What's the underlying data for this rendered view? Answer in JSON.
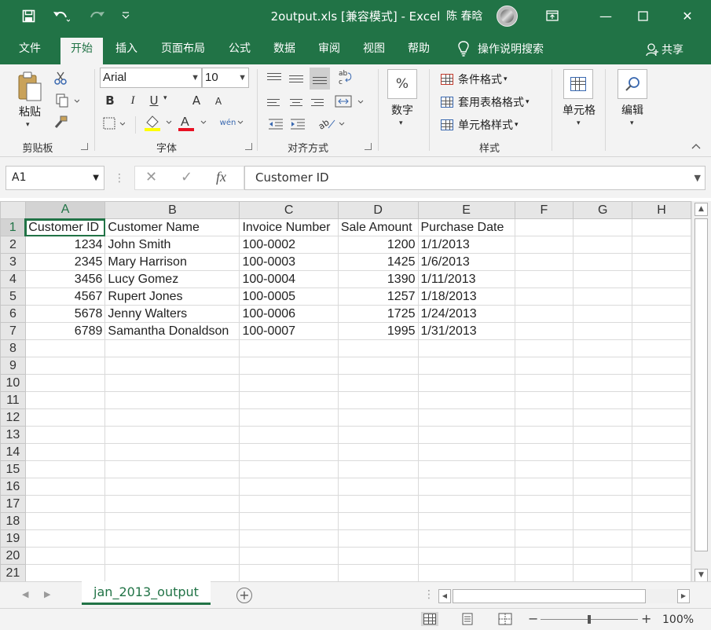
{
  "window": {
    "title": "2output.xls  [兼容模式]  -  Excel",
    "user": "陈 春晗",
    "minimize_glyph": "—",
    "restore_glyph": "❐",
    "close_glyph": "✕"
  },
  "quick_access": {
    "save_icon": "save-icon",
    "undo_icon": "undo-icon",
    "redo_icon": "redo-icon",
    "customize_icon": "customize-icon"
  },
  "tabs": [
    {
      "label": "文件"
    },
    {
      "label": "开始"
    },
    {
      "label": "插入"
    },
    {
      "label": "页面布局"
    },
    {
      "label": "公式"
    },
    {
      "label": "数据"
    },
    {
      "label": "审阅"
    },
    {
      "label": "视图"
    },
    {
      "label": "帮助"
    }
  ],
  "tell_me": "操作说明搜索",
  "share": "共享",
  "ribbon": {
    "clipboard": {
      "paste": "粘贴",
      "group": "剪贴板"
    },
    "font": {
      "name": "Arial",
      "size": "10",
      "group": "字体",
      "bold": "B",
      "italic": "I",
      "underline": "U",
      "grow": "A",
      "shrink": "A",
      "font_color": "A",
      "phonetic": "wén"
    },
    "alignment": {
      "group": "对齐方式"
    },
    "number": {
      "label": "数字",
      "percent": "%"
    },
    "styles": {
      "conditional": "条件格式",
      "table": "套用表格格式",
      "cell": "单元格样式",
      "group": "样式"
    },
    "cells": {
      "label": "单元格"
    },
    "editing": {
      "label": "编辑"
    }
  },
  "formula_bar": {
    "name_box": "A1",
    "formula": "Customer ID",
    "fx": "fx",
    "cancel": "✕",
    "enter": "✓"
  },
  "sheet": {
    "columns": [
      "A",
      "B",
      "C",
      "D",
      "E",
      "F",
      "G",
      "H"
    ],
    "headers": [
      "Customer ID",
      "Customer Name",
      "Invoice Number",
      "Sale Amount",
      "Purchase Date"
    ],
    "rows": [
      [
        "1234",
        "John Smith",
        "100-0002",
        "1200",
        "1/1/2013"
      ],
      [
        "2345",
        "Mary Harrison",
        "100-0003",
        "1425",
        "1/6/2013"
      ],
      [
        "3456",
        "Lucy Gomez",
        "100-0004",
        "1390",
        "1/11/2013"
      ],
      [
        "4567",
        "Rupert Jones",
        "100-0005",
        "1257",
        "1/18/2013"
      ],
      [
        "5678",
        "Jenny Walters",
        "100-0006",
        "1725",
        "1/24/2013"
      ],
      [
        "6789",
        "Samantha Donaldson",
        "100-0007",
        "1995",
        "1/31/2013"
      ]
    ],
    "row_numbers": [
      "1",
      "2",
      "3",
      "4",
      "5",
      "6",
      "7",
      "8",
      "9",
      "10",
      "11",
      "12",
      "13",
      "14",
      "15",
      "16",
      "17",
      "18",
      "19",
      "20",
      "21"
    ]
  },
  "sheet_tabs": [
    {
      "label": "jan_2013_output"
    }
  ],
  "status": {
    "zoom": "100%",
    "zoom_minus": "−",
    "zoom_plus": "+"
  }
}
